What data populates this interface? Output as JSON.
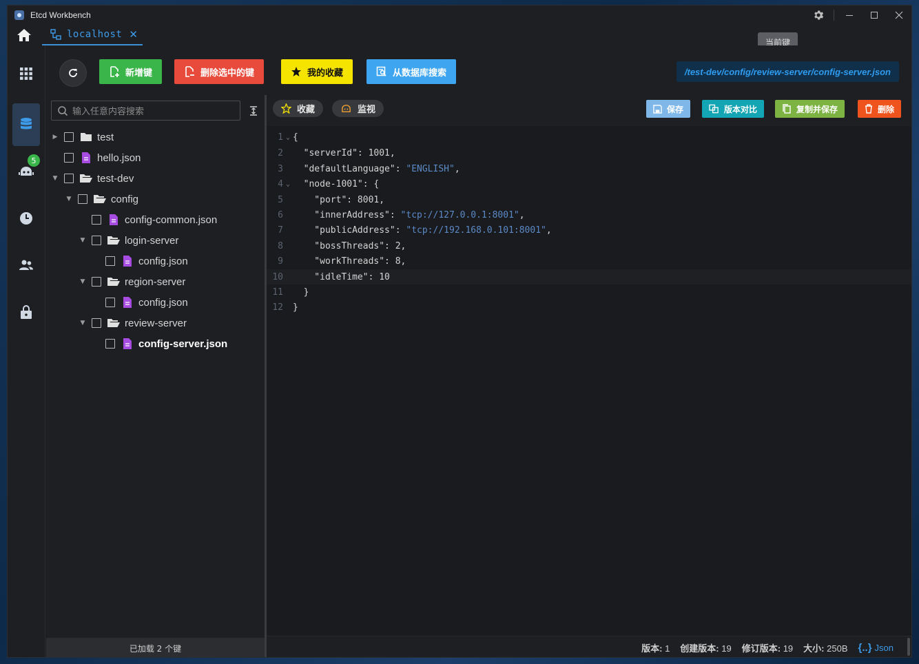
{
  "app": {
    "title": "Etcd Workbench"
  },
  "tabs": [
    {
      "label": "localhost"
    }
  ],
  "tooltip": {
    "text": "当前键"
  },
  "sidenav": {
    "badge_count": "5"
  },
  "toolbar": {
    "add_key": "新增键",
    "delete_selected": "删除选中的键",
    "favorites": "我的收藏",
    "search_db": "从数据库搜索",
    "current_path": "/test-dev/config/review-server/config-server.json"
  },
  "tree": {
    "search_placeholder": "输入任意内容搜索",
    "nodes": [
      {
        "label": "test"
      },
      {
        "label": "hello.json"
      },
      {
        "label": "test-dev"
      },
      {
        "label": "config"
      },
      {
        "label": "config-common.json"
      },
      {
        "label": "login-server"
      },
      {
        "label": "config.json"
      },
      {
        "label": "region-server"
      },
      {
        "label": "config.json"
      },
      {
        "label": "review-server"
      },
      {
        "label": "config-server.json"
      }
    ],
    "footer": "已加载 2 个键"
  },
  "editor": {
    "favorite_label": "收藏",
    "watch_label": "监视",
    "save": "保存",
    "compare": "版本对比",
    "copy_save": "复制并保存",
    "delete": "删除",
    "line_numbers": [
      "1",
      "2",
      "3",
      "4",
      "5",
      "6",
      "7",
      "8",
      "9",
      "10",
      "11",
      "12"
    ],
    "lines": [
      "{",
      "  \"serverId\": 1001,",
      "  \"defaultLanguage\": \"ENGLISH\",",
      "  \"node-1001\": {",
      "    \"port\": 8001,",
      "    \"innerAddress\": \"tcp://127.0.0.1:8001\",",
      "    \"publicAddress\": \"tcp://192.168.0.101:8001\",",
      "    \"bossThreads\": 2,",
      "    \"workThreads\": 8,",
      "    \"idleTime\": 10",
      "  }",
      "}"
    ]
  },
  "status": {
    "version_label": "版本:",
    "version": "1",
    "create_label": "创建版本:",
    "create_rev": "19",
    "mod_label": "修订版本:",
    "mod_rev": "19",
    "size_label": "大小:",
    "size": "250B",
    "format": "Json",
    "format_icon": "{..}"
  },
  "colors": {
    "add": "#3ab54a",
    "delete_sel": "#e84b3c",
    "favorites": "#f5e300",
    "search_db": "#3ea6f0",
    "save": "#7fb8e8",
    "compare": "#13a5b3",
    "copy_save": "#7cb342",
    "delete": "#f0541e",
    "accent": "#3d9be9"
  }
}
